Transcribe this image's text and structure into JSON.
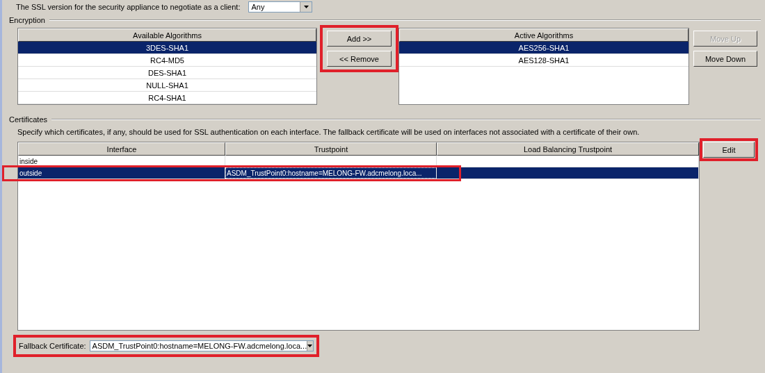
{
  "ssl_version": {
    "label": "The SSL version for the security appliance to negotiate as a client:",
    "value": "Any"
  },
  "encryption": {
    "title": "Encryption",
    "available": {
      "header": "Available Algorithms",
      "rows": [
        {
          "name": "3DES-SHA1",
          "selected": true
        },
        {
          "name": "RC4-MD5",
          "selected": false
        },
        {
          "name": "DES-SHA1",
          "selected": false
        },
        {
          "name": "NULL-SHA1",
          "selected": false
        },
        {
          "name": "RC4-SHA1",
          "selected": false
        }
      ]
    },
    "transfer_buttons": {
      "highlighted": true,
      "items": [
        {
          "label": "Add >>",
          "disabled": false
        },
        {
          "label": "<< Remove",
          "disabled": false
        }
      ]
    },
    "active": {
      "header": "Active Algorithms",
      "rows": [
        {
          "name": "AES256-SHA1",
          "selected": true
        },
        {
          "name": "AES128-SHA1",
          "selected": false
        }
      ]
    },
    "order_buttons": [
      {
        "label": "Move Up",
        "disabled": true
      },
      {
        "label": "Move Down",
        "disabled": false
      }
    ]
  },
  "certificates": {
    "title": "Certificates",
    "description": "Specify which certificates, if any, should be used for SSL authentication on each interface. The fallback certificate will be used on interfaces not associated with a certificate of their own.",
    "table": {
      "columns": [
        "Interface",
        "Trustpoint",
        "Load Balancing Trustpoint"
      ],
      "rows": [
        {
          "cells": [
            "inside",
            "",
            ""
          ],
          "selected": false,
          "highlighted": false
        },
        {
          "cells": [
            "outside",
            "ASDM_TrustPoint0:hostname=MELONG-FW.adcmelong.loca...",
            ""
          ],
          "selected": true,
          "highlighted": true
        }
      ]
    },
    "edit_button": {
      "label": "Edit",
      "highlighted": true
    },
    "fallback": {
      "label": "Fallback Certificate:",
      "value": "ASDM_TrustPoint0:hostname=MELONG-FW.adcmelong.loca...",
      "highlighted": true
    }
  }
}
